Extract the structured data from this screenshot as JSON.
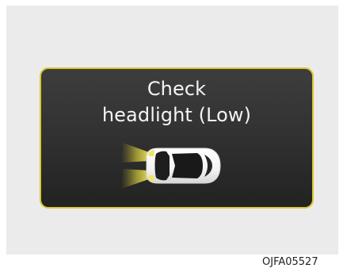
{
  "display": {
    "message_line1": "Check",
    "message_line2": "headlight (Low)",
    "icon": "car-low-beam-warning-icon",
    "frame_color": "#d8c832",
    "light_color": "#e7d94b"
  },
  "figure": {
    "caption": "OJFA05527"
  }
}
